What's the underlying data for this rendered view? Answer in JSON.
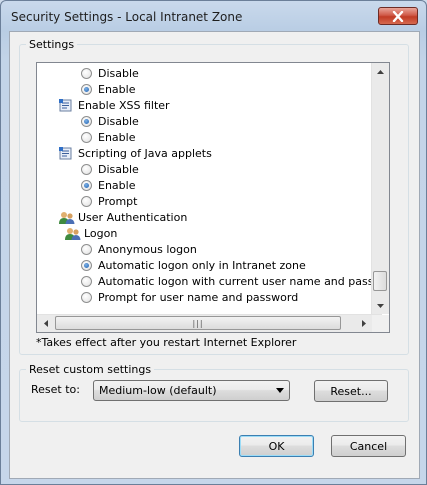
{
  "window": {
    "title": "Security Settings - Local Intranet Zone"
  },
  "settings_group": {
    "title": "Settings"
  },
  "list": {
    "rows": [
      {
        "kind": "radio",
        "label": "Disable",
        "selected": false
      },
      {
        "kind": "radio",
        "label": "Enable",
        "selected": true
      },
      {
        "kind": "category",
        "label": "Enable XSS filter",
        "icon": "setting-icon"
      },
      {
        "kind": "radio",
        "label": "Disable",
        "selected": true
      },
      {
        "kind": "radio",
        "label": "Enable",
        "selected": false
      },
      {
        "kind": "category",
        "label": "Scripting of Java applets",
        "icon": "setting-icon"
      },
      {
        "kind": "radio",
        "label": "Disable",
        "selected": false
      },
      {
        "kind": "radio",
        "label": "Enable",
        "selected": true
      },
      {
        "kind": "radio",
        "label": "Prompt",
        "selected": false
      },
      {
        "kind": "category",
        "label": "User Authentication",
        "icon": "users-icon"
      },
      {
        "kind": "subcategory",
        "label": "Logon",
        "icon": "users-icon"
      },
      {
        "kind": "radio",
        "label": "Anonymous logon",
        "selected": false
      },
      {
        "kind": "radio",
        "label": "Automatic logon only in Intranet zone",
        "selected": true
      },
      {
        "kind": "radio",
        "label": "Automatic logon with current user name and password",
        "selected": false
      },
      {
        "kind": "radio",
        "label": "Prompt for user name and password",
        "selected": false
      }
    ]
  },
  "note": "*Takes effect after you restart Internet Explorer",
  "reset_group": {
    "title": "Reset custom settings",
    "reset_to_label": "Reset to:",
    "reset_level": "Medium-low (default)",
    "reset_button": "Reset..."
  },
  "buttons": {
    "ok": "OK",
    "cancel": "Cancel"
  }
}
